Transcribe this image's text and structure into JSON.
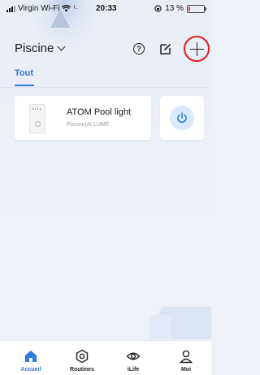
{
  "status_bar": {
    "carrier": "Virgin Wi-Fi",
    "time": "20:33",
    "battery_percent_text": "13 %",
    "battery_level": 0.13,
    "battery_color": "#e53935"
  },
  "header": {
    "home_name": "Piscine",
    "icons": [
      "help-circle-icon",
      "edit-icon",
      "plus-icon"
    ],
    "add_highlight_color": "#e21b1b"
  },
  "tabs": [
    {
      "label": "Tout",
      "active": true
    }
  ],
  "devices": [
    {
      "name": "ATOM Pool light",
      "status": "Piscine|ALLUMÉ",
      "power_on": true
    }
  ],
  "bottom_nav": [
    {
      "label": "Accueil",
      "icon": "home-icon",
      "active": true
    },
    {
      "label": "Routines",
      "icon": "routines-icon",
      "active": false
    },
    {
      "label": "iLife",
      "icon": "eye-icon",
      "active": false
    },
    {
      "label": "Moi",
      "icon": "user-icon",
      "active": false
    }
  ],
  "accent_color": "#2f7bdc"
}
